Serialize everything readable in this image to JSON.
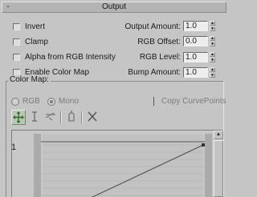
{
  "rollout": {
    "title": "Output",
    "collapse_glyph": "-"
  },
  "checkboxes": [
    {
      "label": "Invert",
      "checked": false
    },
    {
      "label": "Clamp",
      "checked": false
    },
    {
      "label": "Alpha from RGB Intensity",
      "checked": false
    },
    {
      "label": "Enable Color Map",
      "checked": false
    }
  ],
  "params": [
    {
      "label": "Output Amount:",
      "value": "1.0"
    },
    {
      "label": "RGB Offset:",
      "value": "0.0"
    },
    {
      "label": "RGB Level:",
      "value": "1.0"
    },
    {
      "label": "Bump Amount:",
      "value": "1.0"
    }
  ],
  "color_map": {
    "group_title": "Color Map:",
    "rgb_label": "RGB",
    "mono_label": "Mono",
    "mono_selected": true,
    "copy_label": "Copy CurvePoints",
    "copy_checked": false,
    "y_label": "1",
    "tools": [
      "move-point-icon",
      "scale-point-icon",
      "insert-point-icon",
      "reset-icon",
      "delete-point-icon"
    ]
  },
  "spinner": {
    "up_glyph": "▲",
    "down_glyph": "▼"
  },
  "scrollbar": {
    "up_glyph": "▲"
  }
}
